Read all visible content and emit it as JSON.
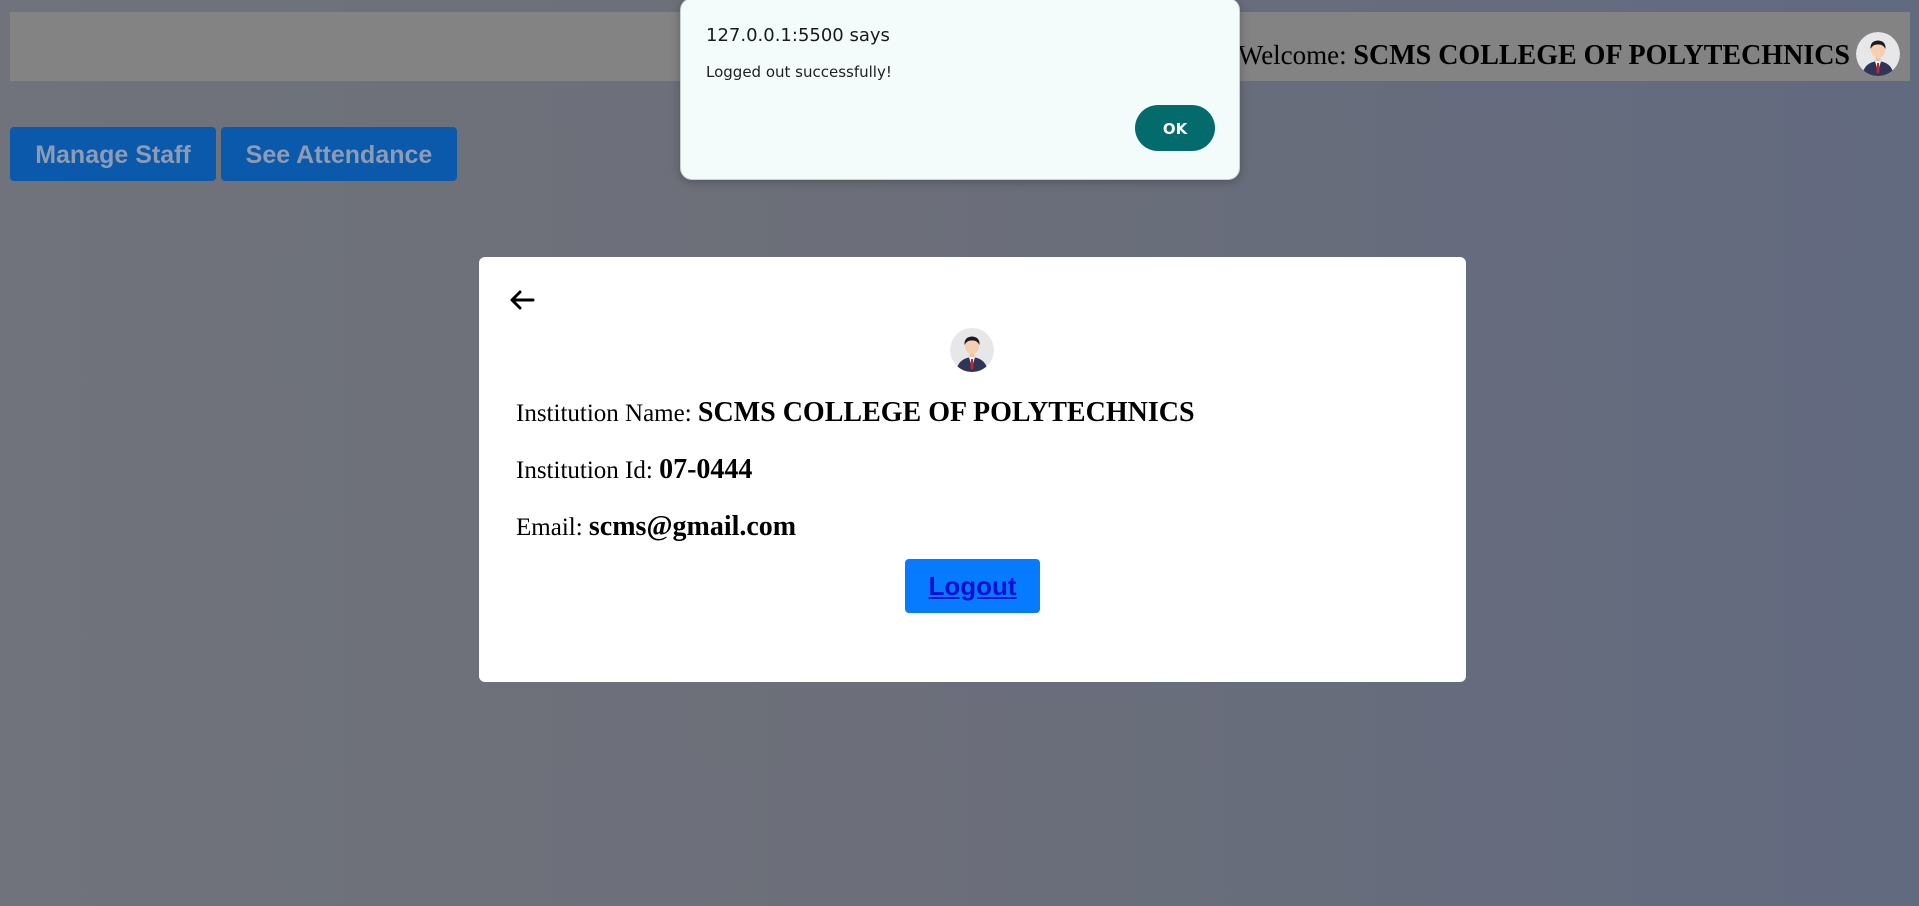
{
  "header": {
    "welcome_label": "Welcome:",
    "institution_name": "SCMS COLLEGE OF POLYTECHNICS",
    "avatar_icon": "user-avatar-icon"
  },
  "toolbar": {
    "manage_staff_label": "Manage Staff",
    "see_attendance_label": "See Attendance"
  },
  "profile": {
    "back_icon": "arrow-left-icon",
    "avatar_icon": "user-avatar-icon",
    "name_label": "Institution Name:",
    "name_value": "SCMS COLLEGE OF POLYTECHNICS",
    "id_label": "Institution Id:",
    "id_value": "07-0444",
    "email_label": "Email:",
    "email_value": "scms@gmail.com",
    "logout_label": "Logout"
  },
  "dialog": {
    "title": "127.0.0.1:5500 says",
    "message": "Logged out successfully!",
    "ok_label": "OK"
  },
  "colors": {
    "overlay": "#6c6f79",
    "button_primary": "#077bff",
    "dialog_ok": "#046b6d",
    "dialog_bg": "#f4fbfb"
  }
}
